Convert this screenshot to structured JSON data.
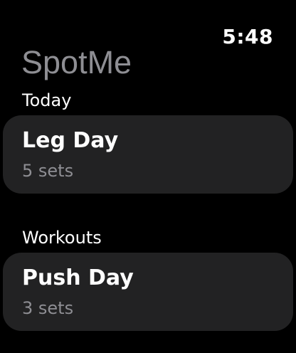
{
  "status": {
    "time": "5:48"
  },
  "app": {
    "title": "SpotMe"
  },
  "sections": {
    "today": {
      "header": "Today",
      "items": [
        {
          "title": "Leg Day",
          "subtitle": "5 sets"
        }
      ]
    },
    "workouts": {
      "header": "Workouts",
      "items": [
        {
          "title": "Push Day",
          "subtitle": "3 sets"
        }
      ]
    }
  },
  "colors": {
    "background": "#000000",
    "card": "#222223",
    "primary_text": "#ffffff",
    "secondary_text": "#8e8e93"
  }
}
